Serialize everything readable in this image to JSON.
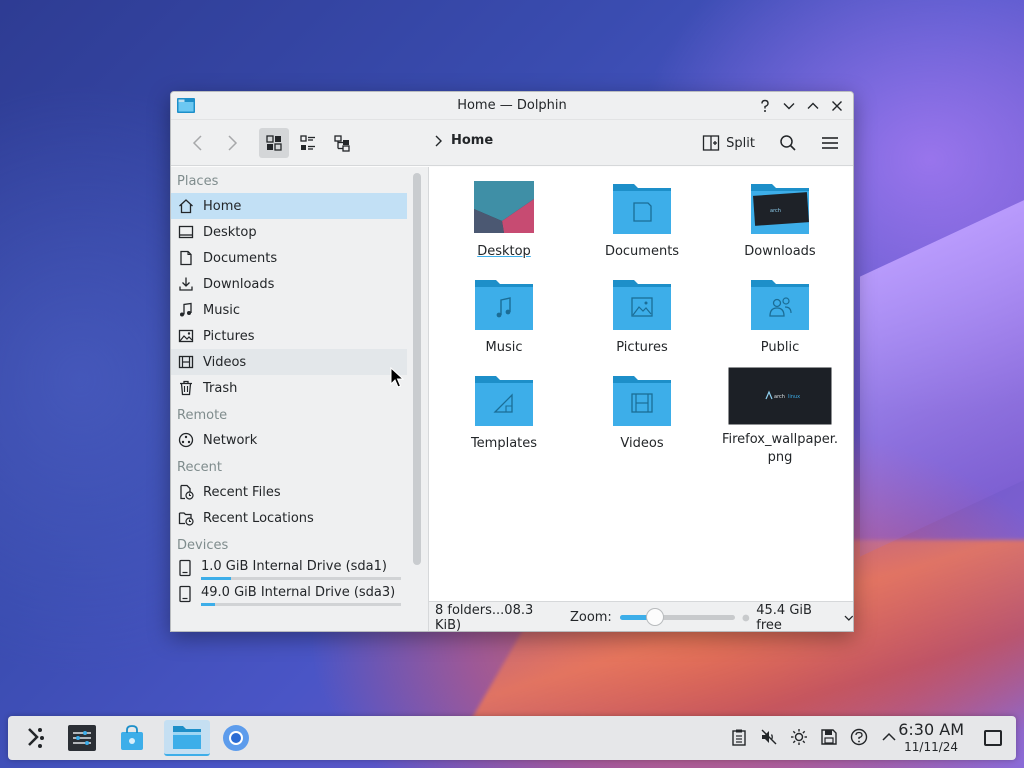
{
  "window": {
    "title": "Home — Dolphin",
    "controls": [
      "help",
      "minimize",
      "maximize",
      "close"
    ]
  },
  "toolbar": {
    "back_icon": "chevron-left-icon",
    "forward_icon": "chevron-right-icon",
    "view_modes": [
      "icons-view",
      "compact-view",
      "details-view"
    ],
    "active_view": "icons-view",
    "breadcrumb": "Home",
    "split_label": "Split"
  },
  "sidebar": {
    "sections": {
      "places": "Places",
      "remote": "Remote",
      "recent": "Recent",
      "devices": "Devices"
    },
    "places": [
      {
        "label": "Home",
        "icon": "home-icon",
        "selected": true
      },
      {
        "label": "Desktop",
        "icon": "desktop-icon"
      },
      {
        "label": "Documents",
        "icon": "document-icon"
      },
      {
        "label": "Downloads",
        "icon": "download-icon"
      },
      {
        "label": "Music",
        "icon": "music-icon"
      },
      {
        "label": "Pictures",
        "icon": "picture-icon"
      },
      {
        "label": "Videos",
        "icon": "video-icon",
        "hover": true
      },
      {
        "label": "Trash",
        "icon": "trash-icon"
      }
    ],
    "remote": [
      {
        "label": "Network",
        "icon": "network-icon"
      }
    ],
    "recent": [
      {
        "label": "Recent Files",
        "icon": "recent-files-icon"
      },
      {
        "label": "Recent Locations",
        "icon": "recent-locations-icon"
      }
    ],
    "devices": [
      {
        "label": "1.0 GiB Internal Drive (sda1)",
        "usage": 0.15
      },
      {
        "label": "49.0 GiB Internal Drive (sda3)",
        "usage": 0.07
      }
    ]
  },
  "content": {
    "items": [
      {
        "label": "Desktop",
        "kind": "desktop-thumb"
      },
      {
        "label": "Documents",
        "kind": "folder-documents"
      },
      {
        "label": "Downloads",
        "kind": "folder-downloads"
      },
      {
        "label": "Music",
        "kind": "folder-music"
      },
      {
        "label": "Pictures",
        "kind": "folder-pictures"
      },
      {
        "label": "Public",
        "kind": "folder-public"
      },
      {
        "label": "Templates",
        "kind": "folder-templates"
      },
      {
        "label": "Videos",
        "kind": "folder-videos"
      },
      {
        "label": "Firefox_wallpaper.\npng",
        "kind": "image-thumb"
      }
    ]
  },
  "statusbar": {
    "summary": "8 folders...08.3 KiB)",
    "zoom_label": "Zoom:",
    "zoom_level": 0.3,
    "free_space": "45.4 GiB free"
  },
  "taskbar": {
    "time": "6:30 AM",
    "date": "11/11/24",
    "apps": [
      "app-launcher",
      "system-settings",
      "discover",
      "dolphin",
      "chromium"
    ],
    "active_app": "dolphin",
    "tray": [
      "clipboard",
      "volume-muted",
      "brightness",
      "storage",
      "updates",
      "tray-expand"
    ]
  },
  "colors": {
    "accent": "#3daee9",
    "folder": "#3daee9",
    "folder_dark": "#1d8fc9"
  }
}
